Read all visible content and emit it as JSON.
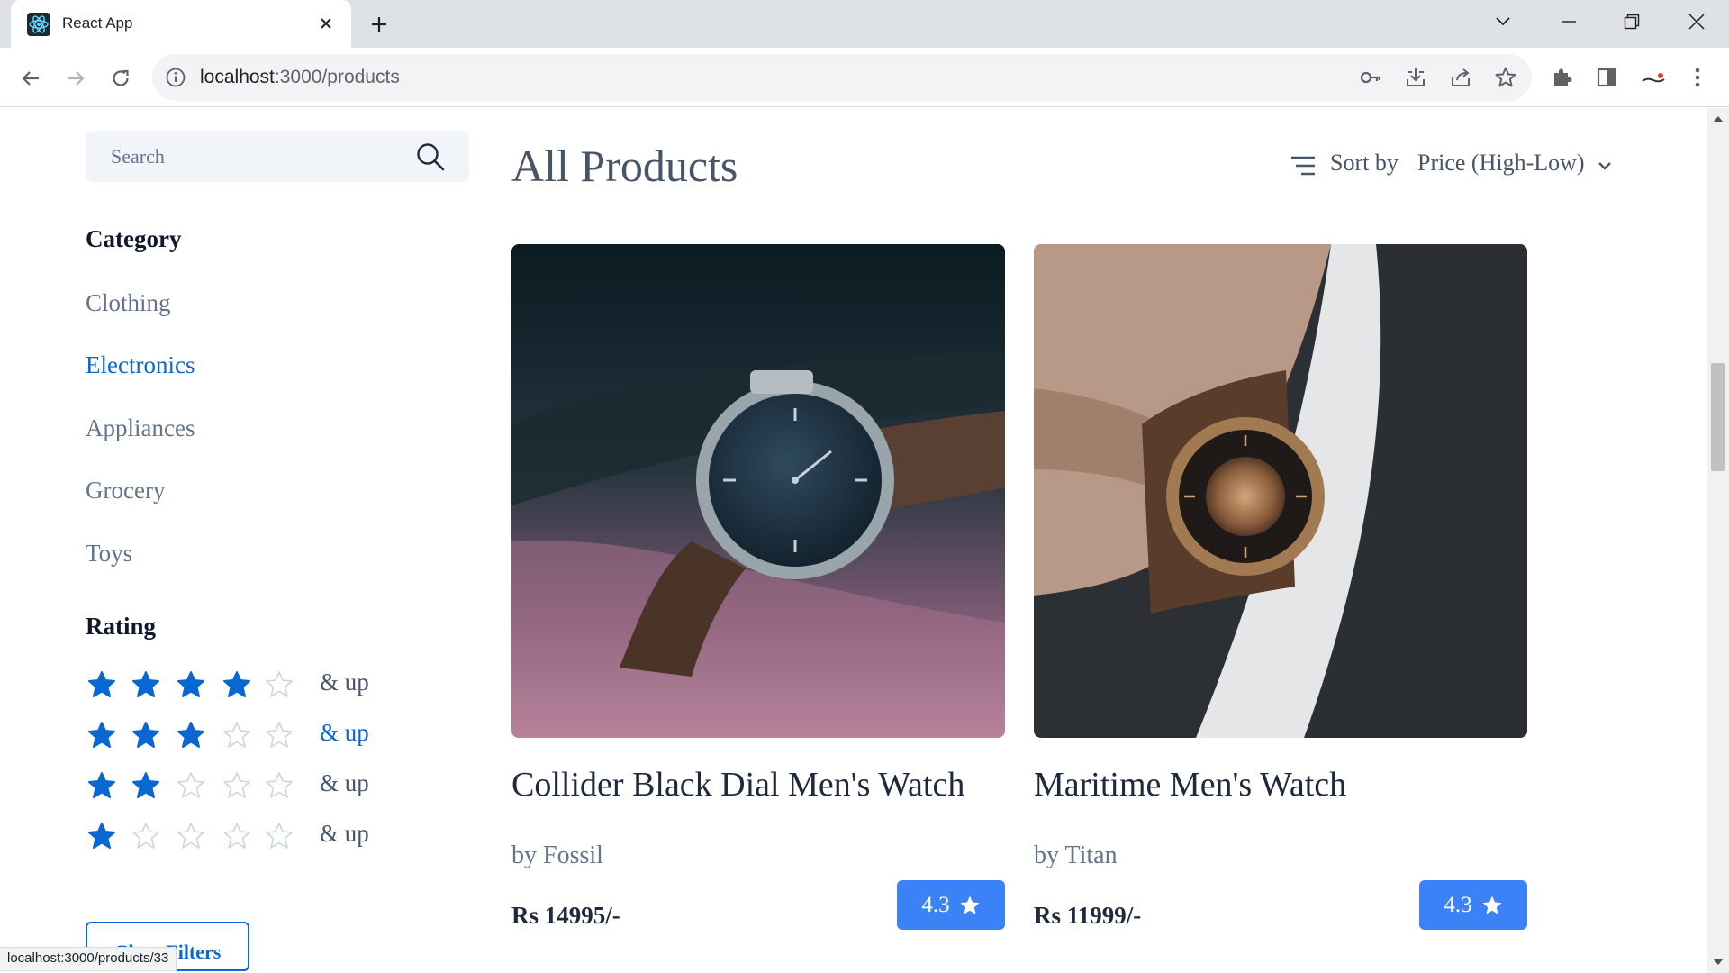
{
  "browser": {
    "tab_title": "React App",
    "url_host": "localhost",
    "url_path": ":3000/products",
    "status_url": "localhost:3000/products/33"
  },
  "search": {
    "placeholder": "Search",
    "value": ""
  },
  "filters": {
    "category_heading": "Category",
    "categories": [
      {
        "label": "Clothing",
        "active": false
      },
      {
        "label": "Electronics",
        "active": true
      },
      {
        "label": "Appliances",
        "active": false
      },
      {
        "label": "Grocery",
        "active": false
      },
      {
        "label": "Toys",
        "active": false
      }
    ],
    "rating_heading": "Rating",
    "ratings": [
      {
        "stars": 4,
        "label": "& up",
        "active": false
      },
      {
        "stars": 3,
        "label": "& up",
        "active": true
      },
      {
        "stars": 2,
        "label": "& up",
        "active": false
      },
      {
        "stars": 1,
        "label": "& up",
        "active": false
      }
    ],
    "clear_label": "Clear Filters"
  },
  "products_header": {
    "title": "All Products",
    "sort_label": "Sort by",
    "sort_value": "Price (High-Low)"
  },
  "products": [
    {
      "name": "Collider Black Dial Men's Watch",
      "brand": "by Fossil",
      "price": "Rs 14995/-",
      "rating": "4.3"
    },
    {
      "name": "Maritime Men's Watch",
      "brand": "by Titan",
      "price": "Rs 11999/-",
      "rating": "4.3"
    }
  ],
  "colors": {
    "accent": "#0967d2",
    "badge": "#3b82f6",
    "muted_text": "#64748b"
  }
}
